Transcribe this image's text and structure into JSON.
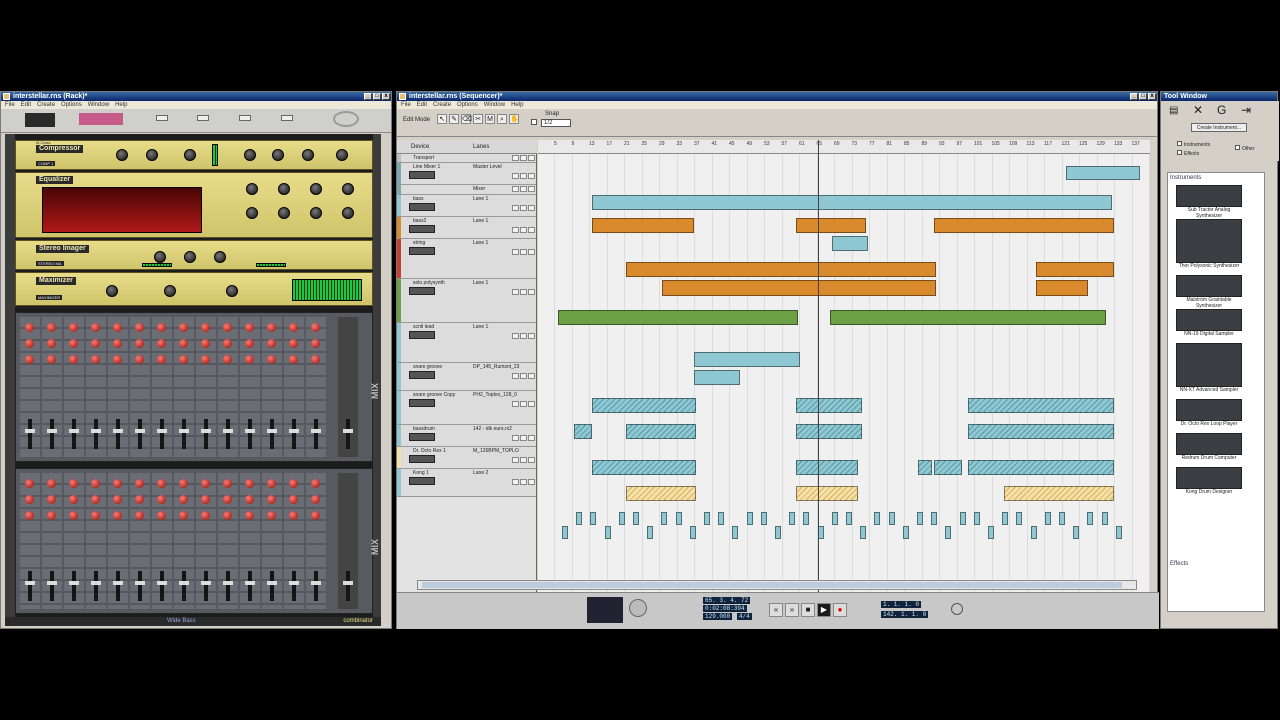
{
  "rack": {
    "title": "interstellar.rns (Rack)*",
    "menu": [
      "File",
      "Edit",
      "Create",
      "Options",
      "Window",
      "Help"
    ],
    "devices": [
      {
        "label": "Compressor",
        "sub": "M-Class",
        "patch": "COMP 1"
      },
      {
        "label": "Equalizer",
        "sub": "M-Class",
        "patch": ""
      },
      {
        "label": "Stereo Imager",
        "sub": "M-Class",
        "patch": "STEREO MA"
      },
      {
        "label": "Maximizer",
        "sub": "M-Class",
        "patch": "MAXIMIZER"
      }
    ],
    "mixer_label": "MIX",
    "mixer_label2": "MIX",
    "bottom_patch": "Wide Bass",
    "bottom_right": "combinator"
  },
  "sequencer": {
    "title": "interstellar.rns (Sequencer)*",
    "menu": [
      "File",
      "Edit",
      "Create",
      "Options",
      "Window",
      "Help"
    ],
    "edit_mode": "Edit Mode",
    "snap_label": "Snap",
    "snap_value": "1/2",
    "col_device": "Device",
    "col_lanes": "Lanes",
    "ruler": [
      "5",
      "9",
      "13",
      "17",
      "21",
      "25",
      "29",
      "33",
      "37",
      "41",
      "45",
      "49",
      "53",
      "57",
      "61",
      "65",
      "69",
      "73",
      "77",
      "81",
      "85",
      "89",
      "93",
      "97",
      "101",
      "105",
      "109",
      "113",
      "117",
      "121",
      "125",
      "129",
      "133",
      "137"
    ],
    "tracks": [
      {
        "name": "Transport",
        "lane": "",
        "color": "#c0c0c0"
      },
      {
        "name": "Line Mixer 1",
        "lane": "Master Level",
        "color": "#7aa7b0"
      },
      {
        "name": "",
        "lane": "Mixer",
        "color": "#7aa7b0"
      },
      {
        "name": "bass",
        "lane": "Lane 1",
        "color": "#8fc7d2"
      },
      {
        "name": "bass2",
        "lane": "Lane 1",
        "color": "#d98a2c"
      },
      {
        "name": "string",
        "lane": "Lane 1",
        "color": "#c8402a"
      },
      {
        "name": "solo polysynth",
        "lane": "Lane 1",
        "color": "#6ba044"
      },
      {
        "name": "scntl lead",
        "lane": "Lane 1",
        "color": "#8fc7d2"
      },
      {
        "name": "snare groove",
        "lane": "DP_145_Rumsnt_23",
        "color": "#8fc7d2"
      },
      {
        "name": "snare groove Copy",
        "lane": "PH2_Toploo_128_0",
        "color": "#8fc7d2"
      },
      {
        "name": "bassdrum",
        "lane": "142 - idk euro.rx2",
        "color": "#8fc7d2"
      },
      {
        "name": "Dr. Octo Rex 1",
        "lane": "M_126BPM_TOPLO",
        "color": "#f5e0a8"
      },
      {
        "name": "Kong 1",
        "lane": "Lane 2",
        "color": "#8fc7d2"
      }
    ],
    "lcd_position": "65. 3. 4. 72",
    "lcd_time": "0:02:08:394",
    "lcd_tempo": "129.000",
    "lcd_sig": "4/4",
    "lcd_left": "1. 1. 1. 0",
    "lcd_right": "142. 1. 1. 0"
  },
  "tool": {
    "title": "Tool Window",
    "create_label": "Create Instrument...",
    "chk_instruments": "Instruments",
    "chk_effects": "Effects",
    "chk_other": "Other",
    "section_instruments": "Instruments",
    "section_effects": "Effects",
    "instruments": [
      "Sub Tractor Analog Synthesizer",
      "Thor Polysonic Synthesizer",
      "Malström Graintable Synthesizer",
      "NN-19 Digital Sampler",
      "NN-XT Advanced Sampler",
      "Dr. Octo Rex Loop Player",
      "Redrum Drum Computer",
      "Kong Drum Designer"
    ]
  }
}
